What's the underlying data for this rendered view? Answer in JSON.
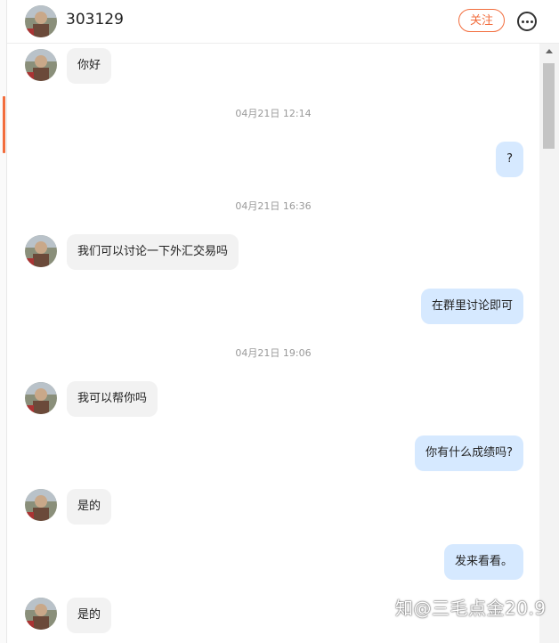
{
  "header": {
    "title": "303129",
    "follow_label": "关注",
    "avatar": "user-avatar"
  },
  "messages": [
    {
      "side": "in",
      "text": "你好"
    },
    {
      "timestamp": "04月21日 12:14"
    },
    {
      "side": "out",
      "text": "?"
    },
    {
      "timestamp": "04月21日 16:36"
    },
    {
      "side": "in",
      "text": "我们可以讨论一下外汇交易吗"
    },
    {
      "side": "out",
      "text": "在群里讨论即可"
    },
    {
      "timestamp": "04月21日 19:06"
    },
    {
      "side": "in",
      "text": "我可以帮你吗"
    },
    {
      "side": "out",
      "text": "你有什么成绩吗?"
    },
    {
      "side": "in",
      "text": "是的"
    },
    {
      "side": "out",
      "text": "发来看看。"
    },
    {
      "side": "in",
      "text": "是的"
    }
  ],
  "watermark": "知@三毛点金20.9",
  "colors": {
    "accent": "#f26d3d",
    "bubble_out": "#d6e9ff",
    "bubble_in": "#f2f2f2"
  }
}
